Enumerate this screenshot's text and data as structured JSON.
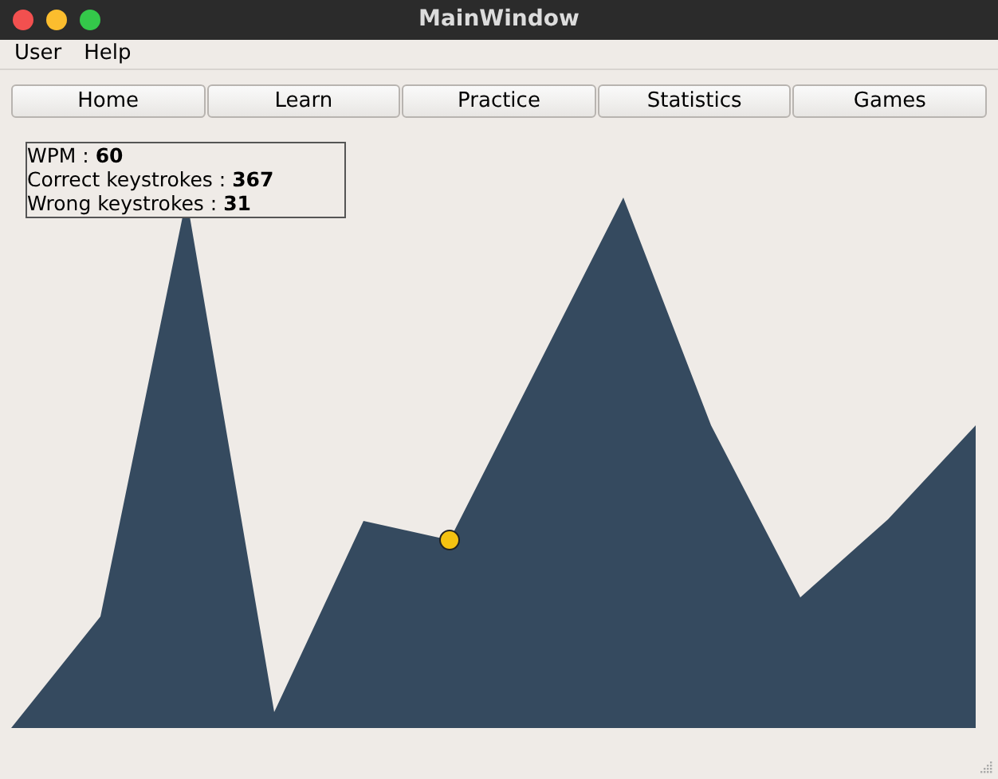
{
  "window": {
    "title": "MainWindow"
  },
  "menu": [
    "User",
    "Help"
  ],
  "tabs": [
    {
      "label": "Home"
    },
    {
      "label": "Learn"
    },
    {
      "label": "Practice"
    },
    {
      "label": "Statistics"
    },
    {
      "label": "Games"
    }
  ],
  "stats": [
    "WPM : **60**",
    "Correct keystrokes : **367**",
    "Wrong keystrokes : **31**"
  ]
}
